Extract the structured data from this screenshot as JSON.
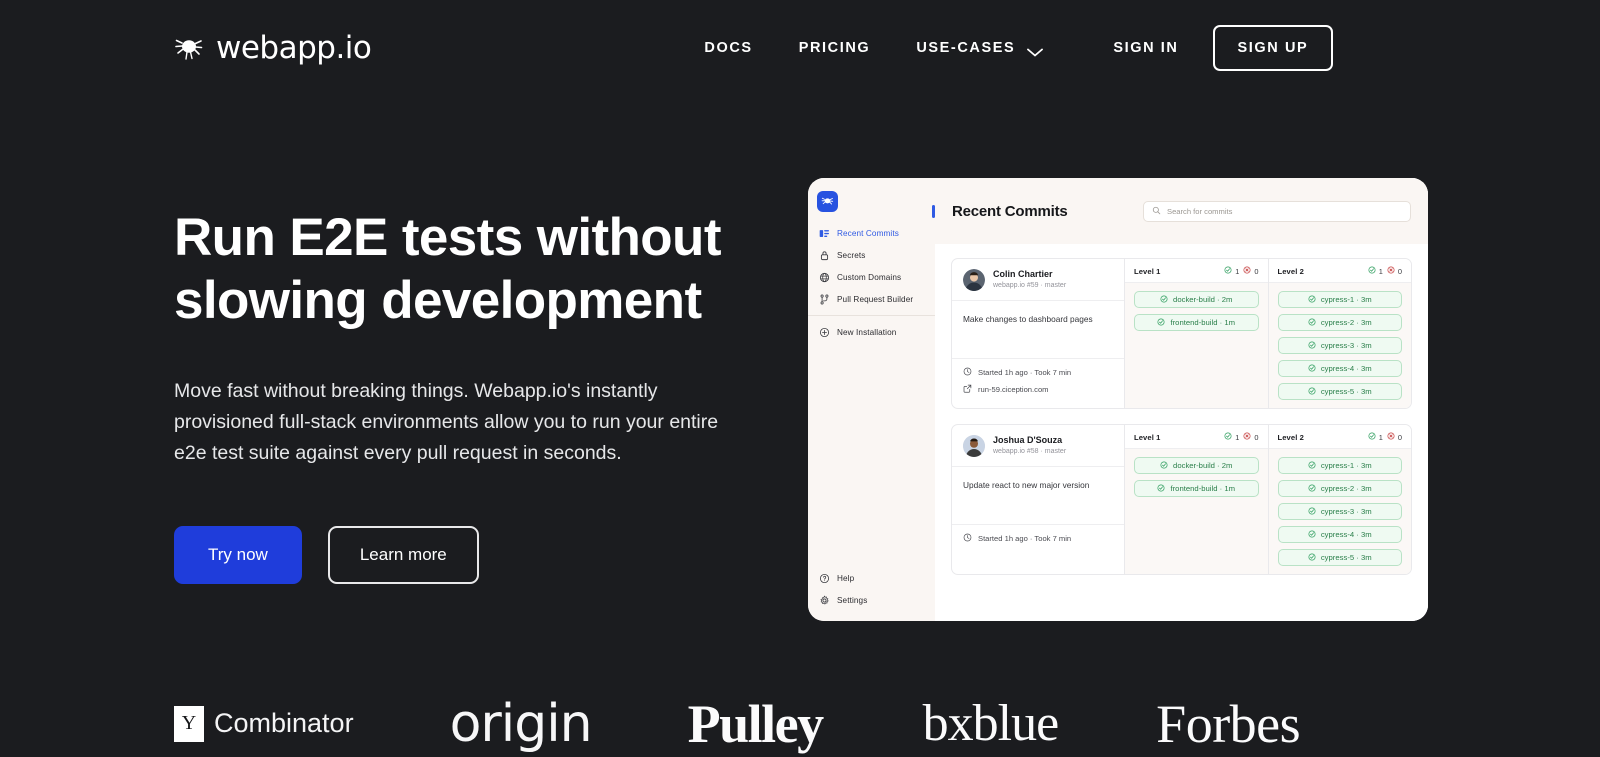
{
  "brand": {
    "name": "webapp.io",
    "logo_icon": "webapp-spider-logo-icon"
  },
  "nav": {
    "links": [
      {
        "label": "DOCS",
        "name": "nav-link-docs"
      },
      {
        "label": "PRICING",
        "name": "nav-link-pricing"
      },
      {
        "label": "USE-CASES",
        "name": "nav-link-use-cases",
        "has_chevron": true
      }
    ],
    "sign_in": "SIGN IN",
    "sign_up": "SIGN UP"
  },
  "hero": {
    "title_line1": "Run E2E tests without",
    "title_line2": "slowing development",
    "subtitle": "Move fast without breaking things. Webapp.io's instantly provisioned full-stack environments allow you to run your entire e2e test suite against every pull request in seconds.",
    "cta_primary": "Try now",
    "cta_secondary": "Learn more",
    "accent_color": "#1f3ddb",
    "background_color": "#1b1c1f"
  },
  "app": {
    "sidebar": {
      "items": [
        {
          "label": "Recent Commits",
          "icon": "list-icon",
          "active": true
        },
        {
          "label": "Secrets",
          "icon": "lock-icon",
          "active": false
        },
        {
          "label": "Custom Domains",
          "icon": "globe-icon",
          "active": false
        },
        {
          "label": "Pull Request Builder",
          "icon": "git-branch-icon",
          "active": false
        }
      ],
      "secondary": [
        {
          "label": "New Installation",
          "icon": "plus-circle-icon"
        }
      ],
      "bottom": [
        {
          "label": "Help",
          "icon": "question-circle-icon"
        },
        {
          "label": "Settings",
          "icon": "gear-icon"
        }
      ]
    },
    "header": {
      "title": "Recent Commits",
      "search_placeholder": "Search for commits"
    },
    "commits": [
      {
        "author": "Colin Chartier",
        "meta": "webapp.io #59 · master",
        "message": "Make changes to dashboard pages",
        "started": "Started 1h ago · Took 7 min",
        "url": "run-59.ciception.com",
        "levels": [
          {
            "name": "Level 1",
            "passed": "1",
            "failed": "0",
            "tasks": [
              {
                "label": "docker-build · 2m",
                "status": "passed"
              },
              {
                "label": "frontend-build · 1m",
                "status": "passed"
              }
            ]
          },
          {
            "name": "Level 2",
            "passed": "1",
            "failed": "0",
            "tasks": [
              {
                "label": "cypress-1 · 3m",
                "status": "passed"
              },
              {
                "label": "cypress-2 · 3m",
                "status": "passed"
              },
              {
                "label": "cypress-3 · 3m",
                "status": "passed"
              },
              {
                "label": "cypress-4 · 3m",
                "status": "passed"
              },
              {
                "label": "cypress-5 · 3m",
                "status": "passed"
              }
            ]
          }
        ]
      },
      {
        "author": "Joshua D'Souza",
        "meta": "webapp.io #58 · master",
        "message": "Update react to new major version",
        "started": "Started 1h ago · Took 7 min",
        "url": "",
        "levels": [
          {
            "name": "Level 1",
            "passed": "1",
            "failed": "0",
            "tasks": [
              {
                "label": "docker-build · 2m",
                "status": "passed"
              },
              {
                "label": "frontend-build · 1m",
                "status": "passed"
              }
            ]
          },
          {
            "name": "Level 2",
            "passed": "1",
            "failed": "0",
            "tasks": [
              {
                "label": "cypress-1 · 3m",
                "status": "passed"
              },
              {
                "label": "cypress-2 · 3m",
                "status": "passed"
              },
              {
                "label": "cypress-3 · 3m",
                "status": "passed"
              },
              {
                "label": "cypress-4 · 3m",
                "status": "passed"
              },
              {
                "label": "cypress-5 · 3m",
                "status": "passed"
              }
            ]
          }
        ]
      }
    ]
  },
  "logos": {
    "yc_letter": "Y",
    "yc_word": "Combinator",
    "origin": "origin",
    "pulley": "Pulley",
    "bxblue": "bxblue",
    "forbes": "Forbes"
  }
}
